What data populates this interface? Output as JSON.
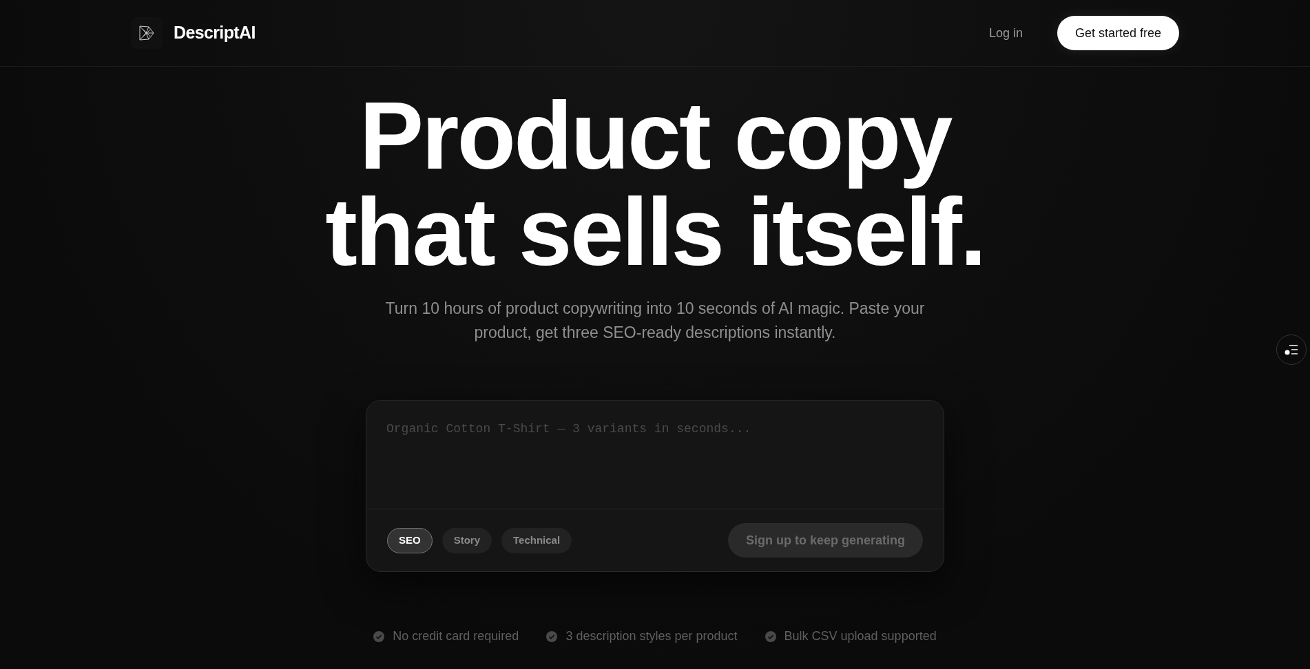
{
  "header": {
    "brand": "DescriptAI",
    "login": "Log in",
    "cta": "Get started free"
  },
  "hero": {
    "title_lines": [
      "Product copy",
      "that sells itself."
    ],
    "subtitle": "Turn 10 hours of product copywriting into 10 seconds of AI magic. Paste your product, get three SEO-ready descriptions instantly."
  },
  "composer": {
    "placeholder": "Organic Cotton T-Shirt — 3 variants in seconds...",
    "styles": [
      {
        "label": "SEO",
        "selected": true
      },
      {
        "label": "Story",
        "selected": false
      },
      {
        "label": "Technical",
        "selected": false
      }
    ],
    "submit": {
      "label": "Sign up to keep generating",
      "disabled": true
    }
  },
  "features": [
    "No credit card required",
    "3 description styles per product",
    "Bulk CSV upload supported"
  ]
}
